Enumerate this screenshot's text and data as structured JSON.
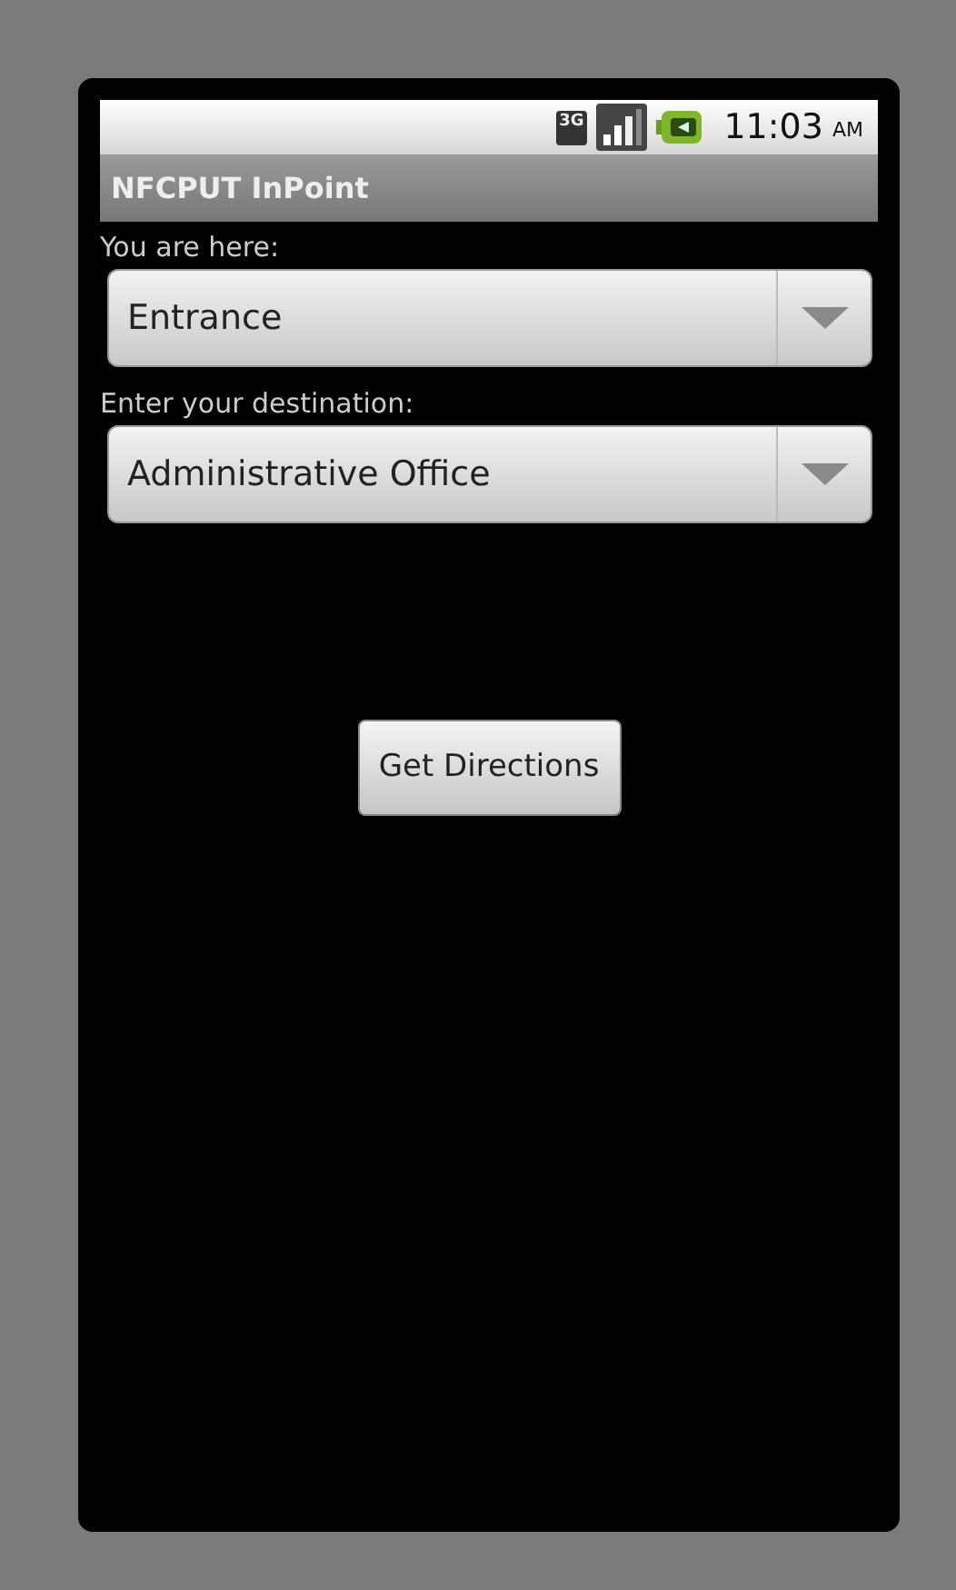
{
  "status_bar": {
    "network": "3G",
    "time": "11:03",
    "meridiem": "AM"
  },
  "title_bar": {
    "title": "NFCPUT InPoint"
  },
  "fields": [
    {
      "label": "You are here:",
      "value": "Entrance"
    },
    {
      "label": "Enter your destination:",
      "value": "Administrative Office"
    }
  ],
  "button": {
    "label": "Get Directions"
  }
}
